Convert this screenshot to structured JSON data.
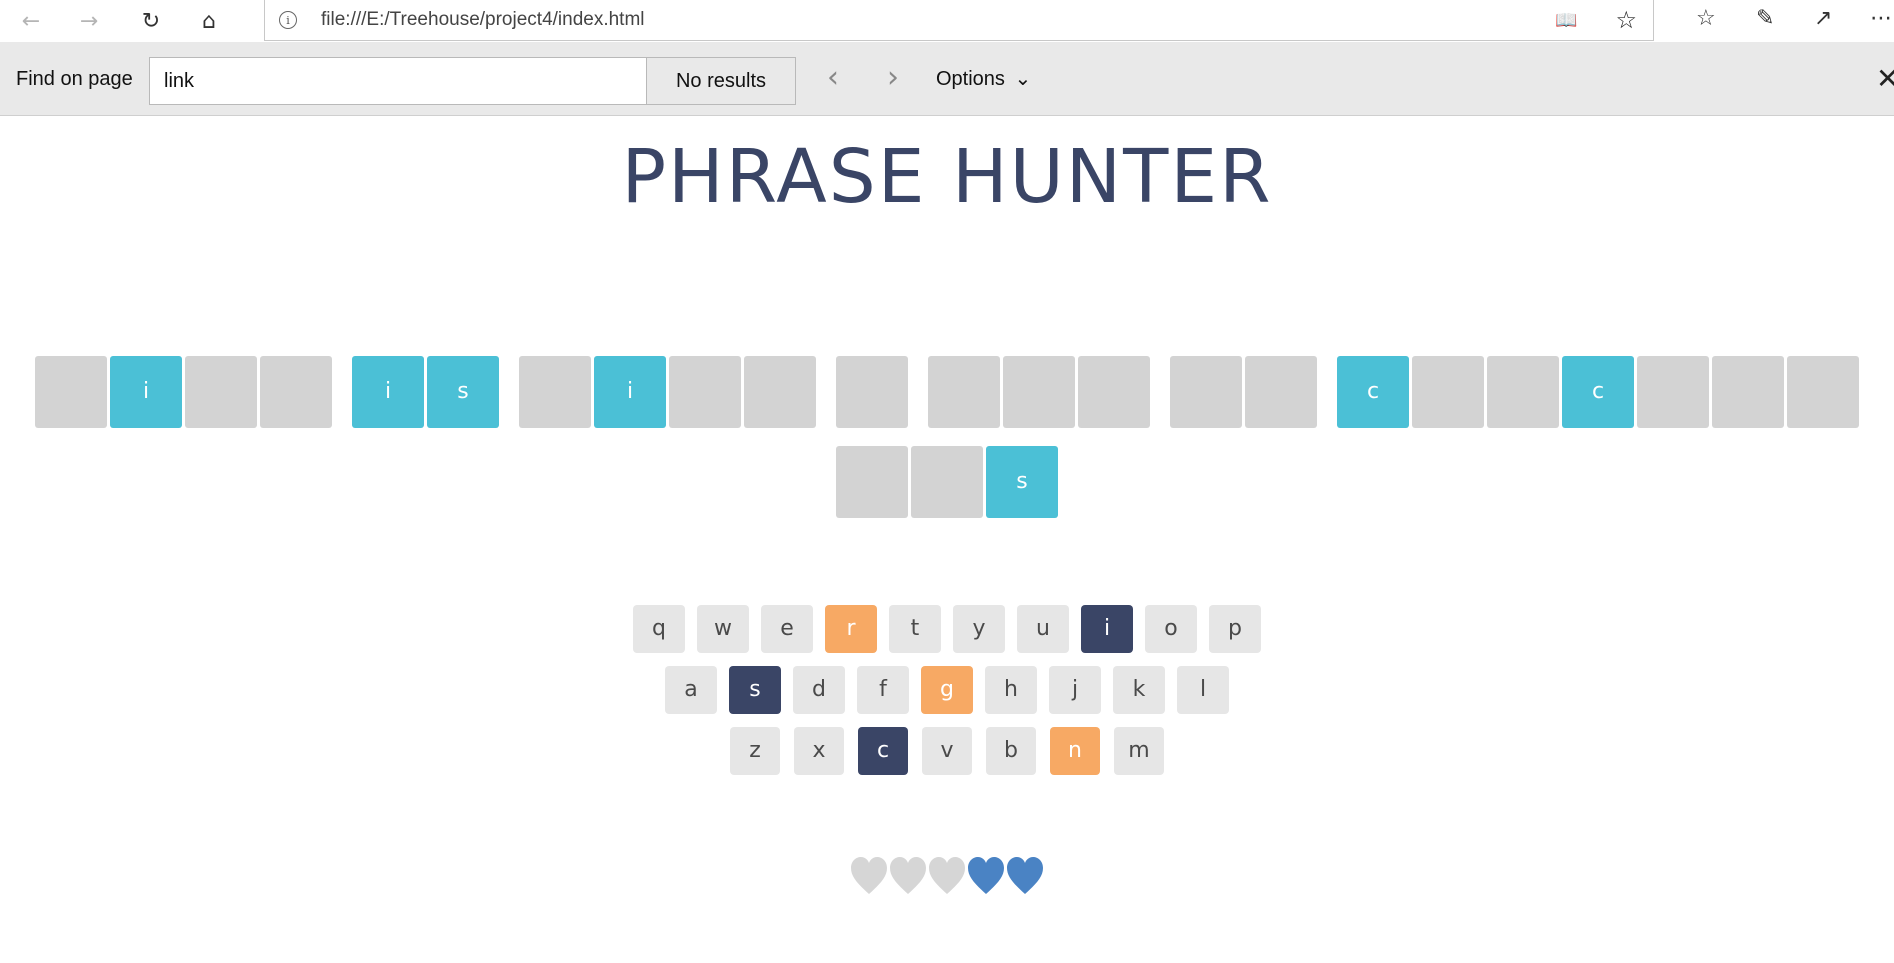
{
  "browser": {
    "url": "file:///E:/Treehouse/project4/index.html",
    "info_icon": "info-icon",
    "find": {
      "label": "Find on page",
      "query": "link",
      "result": "No results",
      "options_label": "Options"
    }
  },
  "game": {
    "title": "PHRASE HUNTER",
    "phrase_tiles": [
      [
        {
          "letter": "",
          "shown": false
        },
        {
          "letter": "i",
          "shown": true
        },
        {
          "letter": "",
          "shown": false
        },
        {
          "letter": "",
          "shown": false
        }
      ],
      [
        {
          "letter": "i",
          "shown": true
        },
        {
          "letter": "s",
          "shown": true
        }
      ],
      [
        {
          "letter": "",
          "shown": false
        },
        {
          "letter": "i",
          "shown": true
        },
        {
          "letter": "",
          "shown": false
        },
        {
          "letter": "",
          "shown": false
        }
      ],
      [
        {
          "letter": "",
          "shown": false
        }
      ],
      [
        {
          "letter": "",
          "shown": false
        },
        {
          "letter": "",
          "shown": false
        },
        {
          "letter": "",
          "shown": false
        }
      ],
      [
        {
          "letter": "",
          "shown": false
        },
        {
          "letter": "",
          "shown": false
        }
      ],
      [
        {
          "letter": "c",
          "shown": true
        },
        {
          "letter": "",
          "shown": false
        },
        {
          "letter": "",
          "shown": false
        },
        {
          "letter": "c",
          "shown": true
        },
        {
          "letter": "",
          "shown": false
        },
        {
          "letter": "",
          "shown": false
        },
        {
          "letter": "",
          "shown": false
        }
      ],
      [
        {
          "letter": "",
          "shown": false
        },
        {
          "letter": "",
          "shown": false
        },
        {
          "letter": "s",
          "shown": true
        }
      ]
    ],
    "keyboard": [
      [
        {
          "k": "q",
          "state": ""
        },
        {
          "k": "w",
          "state": ""
        },
        {
          "k": "e",
          "state": ""
        },
        {
          "k": "r",
          "state": "wrong"
        },
        {
          "k": "t",
          "state": ""
        },
        {
          "k": "y",
          "state": ""
        },
        {
          "k": "u",
          "state": ""
        },
        {
          "k": "i",
          "state": "chosen"
        },
        {
          "k": "o",
          "state": ""
        },
        {
          "k": "p",
          "state": ""
        }
      ],
      [
        {
          "k": "a",
          "state": ""
        },
        {
          "k": "s",
          "state": "chosen"
        },
        {
          "k": "d",
          "state": ""
        },
        {
          "k": "f",
          "state": ""
        },
        {
          "k": "g",
          "state": "wrong"
        },
        {
          "k": "h",
          "state": ""
        },
        {
          "k": "j",
          "state": ""
        },
        {
          "k": "k",
          "state": ""
        },
        {
          "k": "l",
          "state": ""
        }
      ],
      [
        {
          "k": "z",
          "state": ""
        },
        {
          "k": "x",
          "state": ""
        },
        {
          "k": "c",
          "state": "chosen"
        },
        {
          "k": "v",
          "state": ""
        },
        {
          "k": "b",
          "state": ""
        },
        {
          "k": "n",
          "state": "wrong"
        },
        {
          "k": "m",
          "state": ""
        }
      ]
    ],
    "lives": {
      "total": 5,
      "lost": 3
    },
    "colors": {
      "title": "#3a4566",
      "tile_hidden": "#d3d3d3",
      "tile_shown": "#4bc0d6",
      "key_default": "#e6e6e6",
      "key_chosen": "#3a4566",
      "key_wrong": "#f7a964",
      "heart_live": "#4a83c4",
      "heart_lost": "#d6d6d6"
    }
  }
}
